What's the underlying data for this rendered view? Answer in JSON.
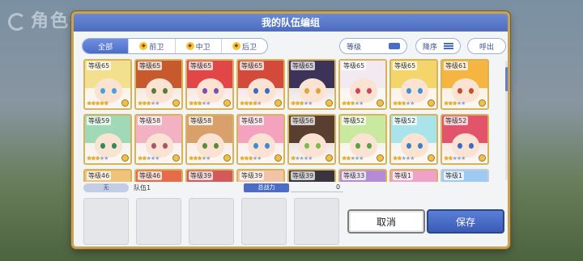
{
  "background": {
    "title": "角色一览"
  },
  "dialog": {
    "title": "我的队伍编组",
    "tabs": [
      {
        "label": "全部",
        "active": true
      },
      {
        "label": "前卫",
        "active": false
      },
      {
        "label": "中卫",
        "active": false
      },
      {
        "label": "后卫",
        "active": false
      }
    ],
    "level_filter": "等级",
    "sort_label": "降序",
    "callout_label": "呼出"
  },
  "characters": [
    {
      "level": "等级65",
      "stars": 5,
      "frame": "gold",
      "hair": "#f3e08f",
      "eye": "#4aa1d8"
    },
    {
      "level": "等级65",
      "stars": 3,
      "frame": "gold",
      "hair": "#c75a2c",
      "eye": "#5a7a3a"
    },
    {
      "level": "等级65",
      "stars": 3,
      "frame": "gold",
      "hair": "#e14747",
      "eye": "#7b4fb0"
    },
    {
      "level": "等级65",
      "stars": 4,
      "frame": "gold",
      "hair": "#d44a3a",
      "eye": "#3b6bc4"
    },
    {
      "level": "等级65",
      "stars": 3,
      "frame": "gold",
      "hair": "#3d3358",
      "eye": "#e0a43b"
    },
    {
      "level": "等级65",
      "stars": 3,
      "frame": "gold",
      "hair": "#f2eaf0",
      "eye": "#d6405a"
    },
    {
      "level": "等级65",
      "stars": 3,
      "frame": "gold",
      "hair": "#f3d56b",
      "eye": "#3f8fd4"
    },
    {
      "level": "等级61",
      "stars": 3,
      "frame": "gold",
      "hair": "#f5b540",
      "eye": "#c44e2b"
    },
    {
      "level": "等级59",
      "stars": 3,
      "frame": "gold",
      "hair": "#9fd9b8",
      "eye": "#2d8c5a"
    },
    {
      "level": "等级58",
      "stars": 2,
      "frame": "gold",
      "hair": "#f2b2c4",
      "eye": "#b0506e"
    },
    {
      "level": "等级58",
      "stars": 3,
      "frame": "gold",
      "hair": "#d8a06a",
      "eye": "#5d8a3b"
    },
    {
      "level": "等级58",
      "stars": 3,
      "frame": "gold",
      "hair": "#f4a3bf",
      "eye": "#3f8ad0"
    },
    {
      "level": "等级56",
      "stars": 1,
      "frame": "gold",
      "hair": "#5a3e30",
      "eye": "#7dbb4c"
    },
    {
      "level": "等级52",
      "stars": 2,
      "frame": "gold",
      "hair": "#c9e8a0",
      "eye": "#5aa33d"
    },
    {
      "level": "等级52",
      "stars": 2,
      "frame": "gold",
      "hair": "#a9e4ea",
      "eye": "#3f7dc4"
    },
    {
      "level": "等级52",
      "stars": 2,
      "frame": "gold",
      "hair": "#e2546a",
      "eye": "#3b6bc4"
    },
    {
      "level": "等级46",
      "stars": 3,
      "frame": "gold",
      "hair": "#f0c27a",
      "eye": "#4a7fc4"
    },
    {
      "level": "等级46",
      "stars": 3,
      "frame": "gold",
      "hair": "#e66b4a",
      "eye": "#4a7fc4"
    },
    {
      "level": "等级39",
      "stars": 3,
      "frame": "gold",
      "hair": "#d45a5a",
      "eye": "#4a7fc4"
    },
    {
      "level": "等级39",
      "stars": 3,
      "frame": "gold",
      "hair": "#f3c3a8",
      "eye": "#4a7fc4"
    },
    {
      "level": "等级39",
      "stars": 3,
      "frame": "gold",
      "hair": "#3a3440",
      "eye": "#4a7fc4"
    },
    {
      "level": "等级33",
      "stars": 3,
      "frame": "gold",
      "hair": "#b58ad6",
      "eye": "#4a7fc4"
    },
    {
      "level": "等级1",
      "stars": 3,
      "frame": "gold",
      "hair": "#f1a0c8",
      "eye": "#4a7fc4"
    },
    {
      "level": "等级1",
      "stars": 3,
      "frame": "silver",
      "hair": "#9ccaf2",
      "eye": "#4a7fc4"
    }
  ],
  "team": {
    "badge": "无",
    "name": "队伍1",
    "power_label": "总战力",
    "power_value": "0",
    "slot_count": 5
  },
  "buttons": {
    "cancel": "取消",
    "save": "保存"
  }
}
